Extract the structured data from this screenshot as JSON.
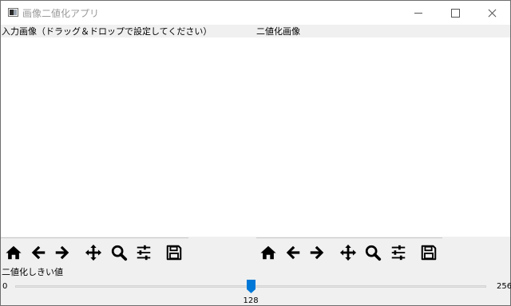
{
  "window": {
    "title": "画像二値化アプリ",
    "icon": "app-icon",
    "controls": [
      "minimize-icon",
      "maximize-icon",
      "close-icon"
    ]
  },
  "panes": {
    "left_label": "入力画像（ドラッグ＆ドロップで設定してください）",
    "right_label": "二値化画像"
  },
  "toolbar": {
    "icons": [
      "home-icon",
      "back-arrow-icon",
      "forward-arrow-icon",
      "pan-icon",
      "zoom-icon",
      "configure-subplots-icon",
      "save-icon"
    ]
  },
  "threshold": {
    "label": "二値化しきい値",
    "min_label": "0",
    "max_label": "256",
    "min": 0,
    "max": 256,
    "value": 128,
    "value_label": "128",
    "accent_color": "#0078d7"
  }
}
